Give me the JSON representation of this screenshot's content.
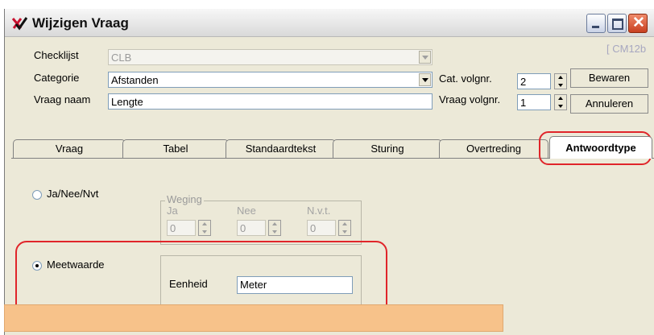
{
  "window": {
    "title": "Wijzigen Vraag",
    "code": "[ CM12b",
    "icon": "checkmark-x-icon",
    "controls": {
      "minimize": "minimize-icon",
      "maximize": "maximize-icon",
      "close": "close-icon"
    }
  },
  "form": {
    "checklist_label": "Checklijst",
    "checklist_value": "CLB",
    "category_label": "Categorie",
    "category_value": "Afstanden",
    "question_name_label": "Vraag naam",
    "question_name_value": "Lengte",
    "cat_order_label": "Cat. volgnr.",
    "cat_order_value": "2",
    "question_order_label": "Vraag volgnr.",
    "question_order_value": "1"
  },
  "buttons": {
    "save": "Bewaren",
    "cancel": "Annuleren"
  },
  "tabs": [
    {
      "label": "Vraag"
    },
    {
      "label": "Tabel"
    },
    {
      "label": "Standaardtekst"
    },
    {
      "label": "Sturing"
    },
    {
      "label": "Overtreding"
    },
    {
      "label": "Antwoordtype",
      "active": true
    }
  ],
  "answer_type": {
    "yes_no_label": "Ja/Nee/Nvt",
    "weighting": {
      "legend": "Weging",
      "yes_label": "Ja",
      "yes_value": "0",
      "no_label": "Nee",
      "no_value": "0",
      "na_label": "N.v.t.",
      "na_value": "0"
    },
    "measure_label": "Meetwaarde",
    "unit_label": "Eenheid",
    "unit_value": "Meter"
  },
  "colors": {
    "annotation": "#e0252a",
    "window_bg": "#ece9d8",
    "overlay": "#f7c28a"
  }
}
